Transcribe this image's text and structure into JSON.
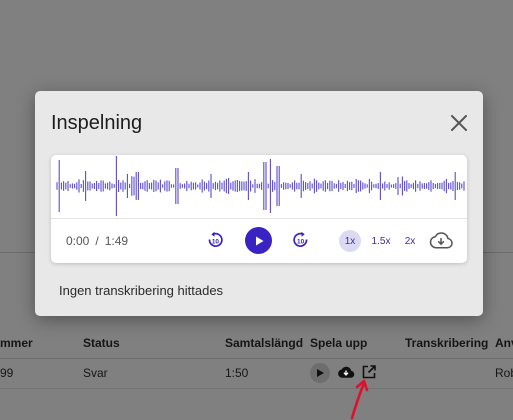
{
  "background": {
    "columns": [
      "mmer",
      "Status",
      "Samtalslängd",
      "Spela upp",
      "Transkribering",
      "Anv"
    ],
    "row": {
      "number": "99",
      "status": "Svar",
      "duration": "1:50",
      "user": "Rob"
    },
    "row_icons": [
      "play-icon",
      "cloud-download-icon",
      "open-external-icon"
    ]
  },
  "modal": {
    "title": "Inspelning",
    "close_icon": "close-icon",
    "player": {
      "current_time": "0:00",
      "separator": "/",
      "total_time": "1:49",
      "rewind_label": "10",
      "forward_label": "10",
      "speeds": [
        "1x",
        "1.5x",
        "2x"
      ],
      "selected_speed": "1x",
      "accent_color": "#3b23c3",
      "waveform_color": "#5b4bd0"
    },
    "no_transcript_text": "Ingen transkribering hittades"
  },
  "annotation": {
    "color": "#e0102a"
  }
}
